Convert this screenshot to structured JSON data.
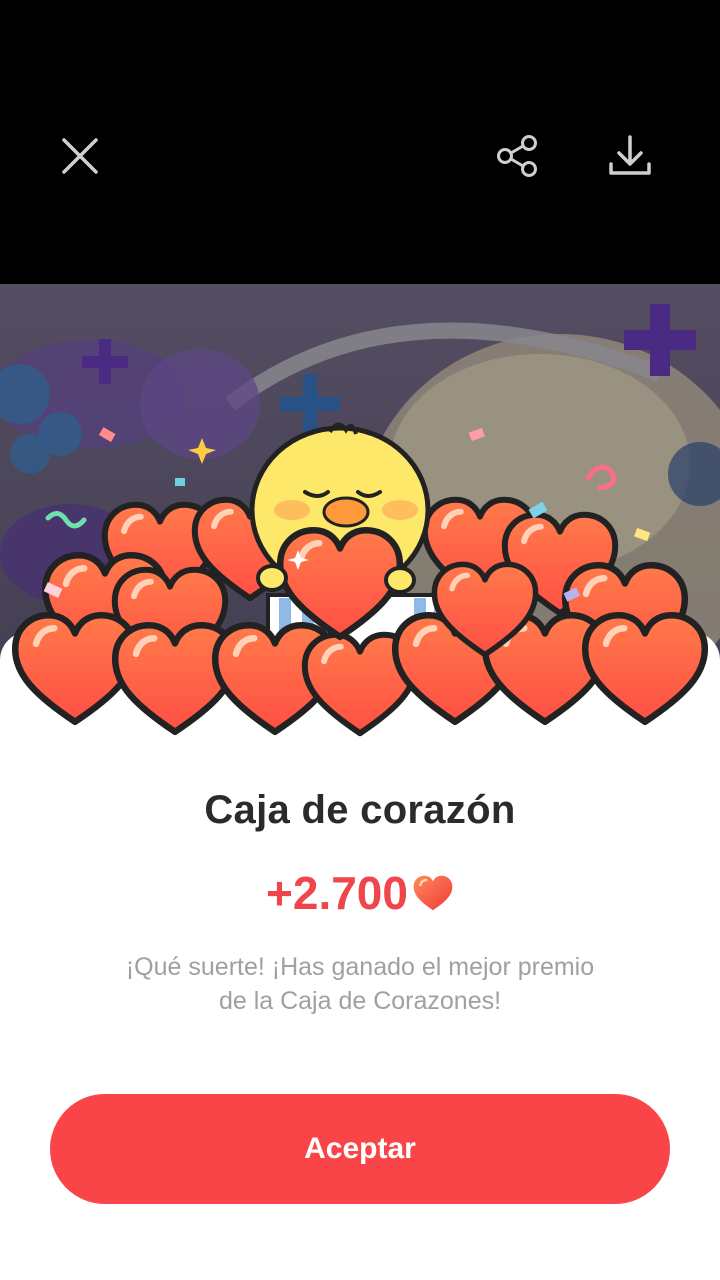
{
  "toolbar": {
    "close_icon": "close-icon",
    "share_icon": "share-icon",
    "download_icon": "download-icon"
  },
  "colors": {
    "accent": "#fa4548",
    "reward_text": "#f0454a",
    "heart_fill": "#ff5a45",
    "title_text": "#2b2b2b",
    "description_text": "#a0a0a0"
  },
  "dialog": {
    "title": "Caja de corazón",
    "reward_amount": "+2.700",
    "reward_icon": "heart-icon",
    "description": "¡Qué suerte! ¡Has ganado el mejor premio de la Caja de Corazones!",
    "accept_label": "Aceptar"
  }
}
